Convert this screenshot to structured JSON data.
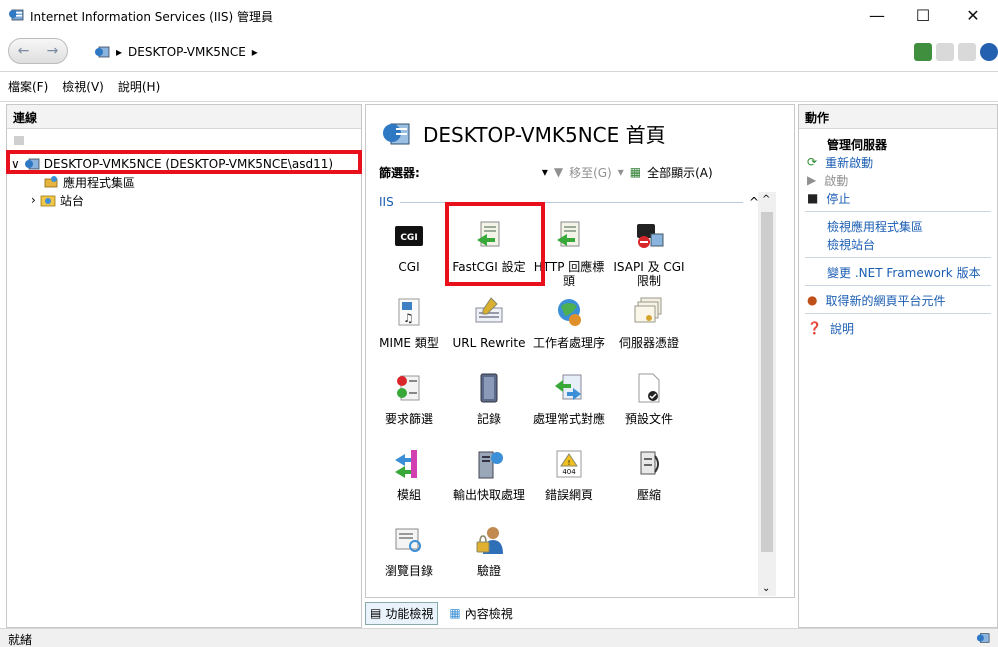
{
  "window": {
    "title": "Internet Information Services (IIS) 管理員"
  },
  "address": {
    "path": "DESKTOP-VMK5NCE"
  },
  "menu": [
    "檔案(F)",
    "檢視(V)",
    "說明(H)"
  ],
  "connections": {
    "header": "連線",
    "tree": {
      "server": "DESKTOP-VMK5NCE (DESKTOP-VMK5NCE\\asd11)",
      "app_pools": "應用程式集區",
      "sites": "站台"
    }
  },
  "center": {
    "title": "DESKTOP-VMK5NCE 首頁",
    "filter_label": "篩選器:",
    "goto_label": "移至(G)",
    "show_all_label": "全部顯示(A)",
    "group_label": "IIS",
    "features": [
      {
        "label": "CGI",
        "icon": "cgi-icon"
      },
      {
        "label": "FastCGI 設定",
        "icon": "fastcgi-icon"
      },
      {
        "label": "HTTP 回應標頭",
        "icon": "http-headers-icon"
      },
      {
        "label": "ISAPI 及 CGI 限制",
        "icon": "isapi-cgi-icon"
      },
      {
        "label": "MIME 類型",
        "icon": "mime-icon"
      },
      {
        "label": "URL Rewrite",
        "icon": "url-rewrite-icon"
      },
      {
        "label": "工作者處理序",
        "icon": "worker-process-icon"
      },
      {
        "label": "伺服器憑證",
        "icon": "certificate-icon"
      },
      {
        "label": "要求篩選",
        "icon": "request-filter-icon"
      },
      {
        "label": "記錄",
        "icon": "logging-icon"
      },
      {
        "label": "處理常式對應",
        "icon": "handler-map-icon"
      },
      {
        "label": "預設文件",
        "icon": "default-doc-icon"
      },
      {
        "label": "模組",
        "icon": "modules-icon"
      },
      {
        "label": "輸出快取處理",
        "icon": "output-cache-icon"
      },
      {
        "label": "錯誤網頁",
        "icon": "error-pages-icon"
      },
      {
        "label": "壓縮",
        "icon": "compression-icon"
      },
      {
        "label": "瀏覽目錄",
        "icon": "dir-browse-icon"
      },
      {
        "label": "驗證",
        "icon": "auth-icon"
      }
    ],
    "tabs": {
      "features_view": "功能檢視",
      "content_view": "內容檢視"
    }
  },
  "actions": {
    "header": "動作",
    "manage_server": "管理伺服器",
    "restart": "重新啟動",
    "start": "啟動",
    "stop": "停止",
    "view_app_pools": "檢視應用程式集區",
    "view_sites": "檢視站台",
    "change_net": "變更 .NET Framework 版本",
    "get_components": "取得新的網頁平台元件",
    "help": "說明"
  },
  "status": {
    "text": "就緒"
  },
  "colors": {
    "highlight": "#e8101b",
    "link": "#1a5db3"
  }
}
